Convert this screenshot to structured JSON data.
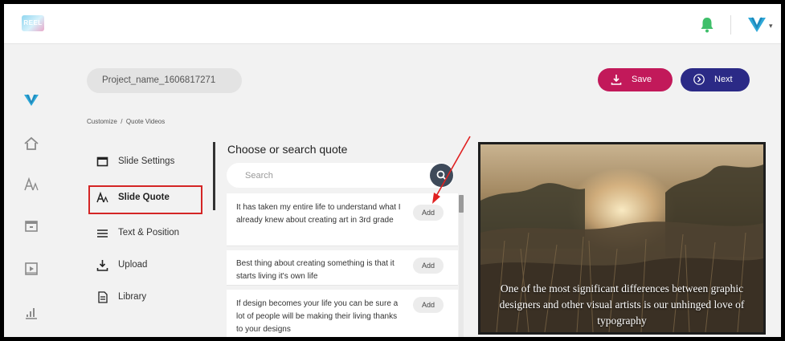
{
  "app": {
    "logo_text": "REEL",
    "accent_color": "#c2195a",
    "primary_color": "#2b2a86",
    "notification_color": "#3fbf6a"
  },
  "header": {
    "icons": [
      "bell-icon",
      "brand-logo-icon",
      "chevron-down-icon"
    ]
  },
  "sidebar": {
    "icons": [
      "brand-logo-icon",
      "home-icon",
      "text-icon",
      "window-icon",
      "video-icon",
      "chart-icon"
    ]
  },
  "project": {
    "name": "Project_name_1606817271"
  },
  "toolbar": {
    "save_label": "Save",
    "next_label": "Next"
  },
  "breadcrumb": "Customize  /  Quote Videos",
  "menu": {
    "items": [
      {
        "label": "Slide Settings",
        "icon": "slide-icon"
      },
      {
        "label": "Slide Quote",
        "icon": "text-icon",
        "active": true
      },
      {
        "label": "Text & Position",
        "icon": "lines-icon"
      },
      {
        "label": "Upload",
        "icon": "upload-icon"
      },
      {
        "label": "Library",
        "icon": "document-icon"
      }
    ]
  },
  "quotes": {
    "title": "Choose or search quote",
    "search_placeholder": "Search",
    "add_label": "Add",
    "items": [
      {
        "text": "It has taken my entire life to understand what I already knew about creating art in 3rd grade"
      },
      {
        "text": "Best thing about creating something is that it starts living it's own life"
      },
      {
        "text": "If design becomes your life you can be sure a lot of people will be making their living thanks to your designs"
      }
    ]
  },
  "preview": {
    "caption": "One of the most significant differences between graphic designers and other visual artists is our unhinged love of typography"
  }
}
